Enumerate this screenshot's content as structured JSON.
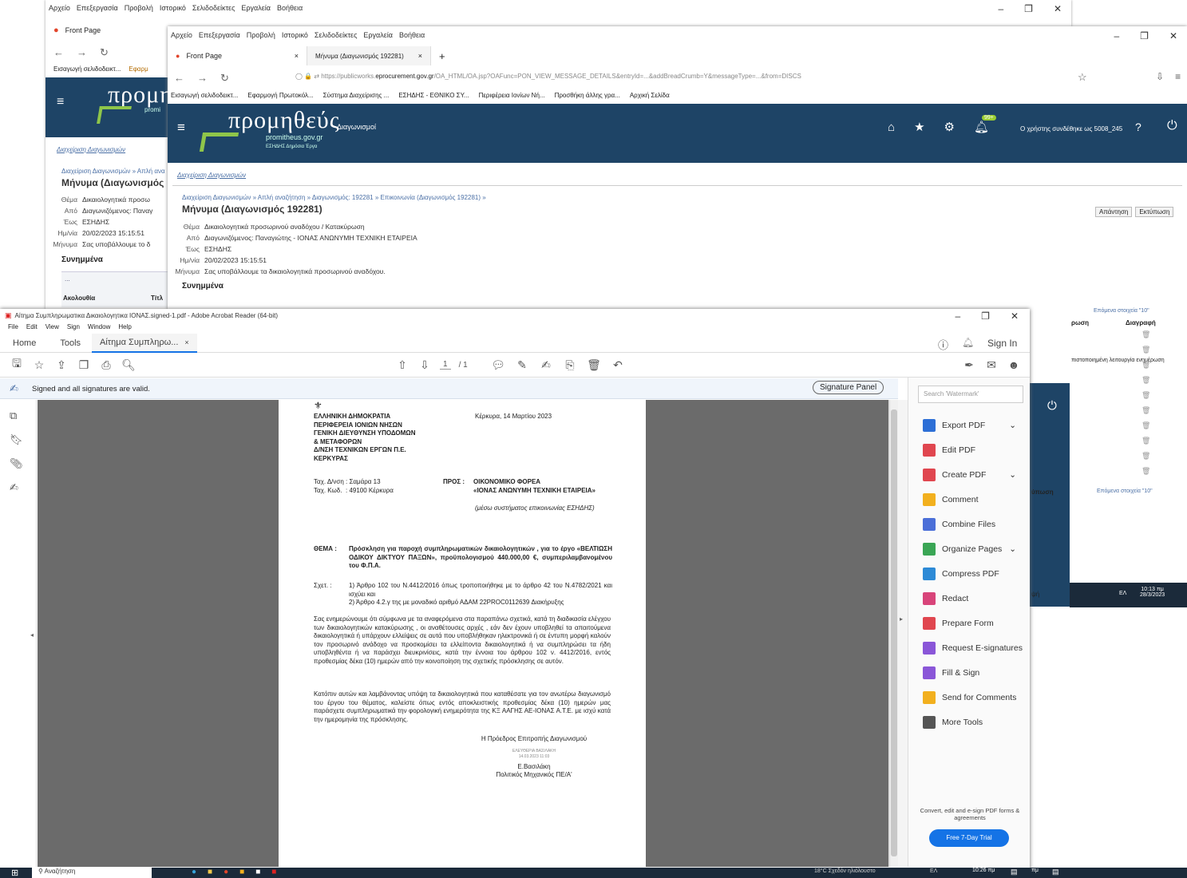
{
  "win1": {
    "menu": [
      "Αρχείο",
      "Επεξεργασία",
      "Προβολή",
      "Ιστορικό",
      "Σελιδοδείκτες",
      "Εργαλεία",
      "Βοήθεια"
    ],
    "tab_title": "Front Page",
    "bookmark1": "Εισαγωγή σελιδοδεικτ...",
    "bookmark2": "Εφαρμ",
    "logo": "προμη",
    "logo_sub": "promi",
    "nav_link": "Διαχείριση Διαγωνισμών",
    "breadcrumb": "Διαχείριση Διαγωνισμών  »  Απλή ανα",
    "title": "Μήνυμα (Διαγωνισμός",
    "fields": [
      {
        "k": "Θέμα",
        "v": "Δικαιολογητικά προσω"
      },
      {
        "k": "Από",
        "v": "Διαγωνιζόμενος: Παναγ"
      },
      {
        "k": "Έως",
        "v": "ΕΣΗΔΗΣ"
      },
      {
        "k": "Ημ/νία",
        "v": "20/02/2023 15:15:51"
      },
      {
        "k": "Μήνυμα",
        "v": "Σας υποβάλλουμε το δ"
      }
    ],
    "attachments": "Συνημμένα",
    "dots": "...",
    "col1": "Ακολουθία",
    "col2": "Τίτλ"
  },
  "win2": {
    "menu": [
      "Αρχείο",
      "Επεξεργασία",
      "Προβολή",
      "Ιστορικό",
      "Σελιδοδείκτες",
      "Εργαλεία",
      "Βοήθεια"
    ],
    "tab1": "Front Page",
    "tab2": "Μήνυμα (Διαγωνισμός 192281)",
    "url_prefix": "https://publicworks.",
    "url_domain": "eprocurement.gov.gr",
    "url_rest": "/OA_HTML/OA.jsp?OAFunc=PON_VIEW_MESSAGE_DETAILS&entryId=...&addBreadCrumb=Y&messageType=...&from=DISCS",
    "bookmarks": [
      "Εισαγωγή σελιδοδεικτ...",
      "Εφαρμογή Πρωτοκόλ...",
      "Σύστημα Διαχείρισης ...",
      "ΕΣΗΔΗΣ - ΕΘΝΙΚΟ ΣΥ...",
      "Περιφέρεια Ιονίων Νή...",
      "Προσθήκη άλλης γρα...",
      "Αρχική Σελίδα"
    ],
    "logo": "προμηθεύς",
    "logo_suffix": "Διαγωνισμοί",
    "logo_sub": "promitheus.gov.gr",
    "logo_sub2": "ΕΣΗΔΗΣ  Δημόσια Έργα",
    "badge": "99+",
    "user": "Ο χρήστης συνδέθηκε ως 5008_245",
    "nav_link": "Διαχείριση Διαγωνισμών",
    "breadcrumb": "Διαχείριση Διαγωνισμών  »  Απλή αναζήτηση  »  Διαγωνισμός: 192281  »  Επικοινωνία (Διαγωνισμός 192281)  »",
    "title": "Μήνυμα (Διαγωνισμός 192281)",
    "btn_reply": "Απάντηση",
    "btn_print": "Εκτύπωση",
    "fields": [
      {
        "k": "Θέμα",
        "v": "Δικαιολογητικά προσωρινού αναδόχου / Κατακύρωση"
      },
      {
        "k": "Από",
        "v": "Διαγωνιζόμενος: Παναγιώτης - ΙΟΝΑΣ ΑΝΩΝΥΜΗ ΤΕΧΝΙΚΗ ΕΤΑΙΡΕΙΑ"
      },
      {
        "k": "Έως",
        "v": "ΕΣΗΔΗΣ"
      },
      {
        "k": "Ημ/νία",
        "v": "20/02/2023 15:15:51"
      },
      {
        "k": "Μήνυμα",
        "v": "Σας υποβάλλουμε τα δικαιολογητικά προσωρινού αναδόχου."
      }
    ],
    "attachments": "Συνημμένα",
    "right_next": "Επόμενα στοιχεία \"10\"",
    "right_col1": "ρωση",
    "right_col2": "Διαγραφή",
    "right_note": "πιστοποιημένη λειτουργία ενημέρωση",
    "right_label": "ύπωση",
    "right_label2": "ψή",
    "clock_time": "10:13 πμ",
    "clock_date": "28/3/2023",
    "lang": "ΕΛ"
  },
  "acrobat": {
    "title": "Αίτημα Συμπληρωματικα Δικαιολογητικα ΙΟΝΑΣ.signed-1.pdf - Adobe Acrobat Reader (64-bit)",
    "menu": [
      "File",
      "Edit",
      "View",
      "Sign",
      "Window",
      "Help"
    ],
    "tab_home": "Home",
    "tab_tools": "Tools",
    "tab_doc": "Αίτημα Συμπληρω...",
    "sign_in": "Sign In",
    "page_current": "1",
    "page_total": "/ 1",
    "signed_msg": "Signed and all signatures are valid.",
    "signature_panel": "Signature Panel",
    "search_placeholder": "Search 'Watermark'",
    "tools": [
      {
        "label": "Export PDF",
        "color": "#2d6fd6",
        "chev": true
      },
      {
        "label": "Edit PDF",
        "color": "#e0464f",
        "chev": false
      },
      {
        "label": "Create PDF",
        "color": "#e0464f",
        "chev": true
      },
      {
        "label": "Comment",
        "color": "#f2b01e",
        "chev": false
      },
      {
        "label": "Combine Files",
        "color": "#4b6fd8",
        "chev": false
      },
      {
        "label": "Organize Pages",
        "color": "#3aa655",
        "chev": true
      },
      {
        "label": "Compress PDF",
        "color": "#2d8ad6",
        "chev": false
      },
      {
        "label": "Redact",
        "color": "#d8447a",
        "chev": false
      },
      {
        "label": "Prepare Form",
        "color": "#e0464f",
        "chev": false
      },
      {
        "label": "Request E-signatures",
        "color": "#8a56d8",
        "chev": false
      },
      {
        "label": "Fill & Sign",
        "color": "#8a56d8",
        "chev": false
      },
      {
        "label": "Send for Comments",
        "color": "#f2b01e",
        "chev": false
      },
      {
        "label": "More Tools",
        "color": "#555555",
        "chev": false
      }
    ],
    "promo_text": "Convert, edit and e-sign PDF forms & agreements",
    "trial_btn": "Free 7-Day Trial"
  },
  "pdf": {
    "header_left": [
      "ΕΛΛΗΝΙΚΗ ΔΗΜΟΚΡΑΤΙΑ",
      "ΠΕΡΙΦΕΡΕΙΑ ΙΟΝΙΩΝ ΝΗΣΩΝ",
      "ΓΕΝΙΚΗ ΔΙΕΥΘΥΝΣΗ ΥΠΟΔΟΜΩΝ",
      "& ΜΕΤΑΦΟΡΩΝ",
      "Δ/ΝΣΗ ΤΕΧΝΙΚΩΝ ΕΡΓΩΝ Π.Ε.",
      "ΚΕΡΚΥΡΑΣ"
    ],
    "place_date": "Κέρκυρα,  14 Μαρτίου 2023",
    "addr_k1": "Ταχ. Δ/νση",
    "addr_v1": ":   Σαμάρα 13",
    "addr_k2": "Ταχ. Κωδ.",
    "addr_v2": ":   49100 Κέρκυρα",
    "to_label": "ΠΡΟΣ :",
    "to_v1": "ΟΙΚΟΝΟΜΙΚΟ ΦΟΡΕΑ",
    "to_v2": "«ΙΟΝΑΣ ΑΝΩΝΥΜΗ ΤΕΧΝΙΚΗ ΕΤΑΙΡΕΙΑ»",
    "to_v3": "(μέσω συστήματος επικοινωνίας ΕΣΗΔΗΣ)",
    "subject_label": "ΘΕΜΑ :",
    "subject": "Πρόσκληση για παροχή συμπληρωματικών δικαιολογητικών , για το έργο «ΒΕΛΤΙΩΣΗ ΟΔΙΚΟΥ ΔΙΚΤΥΟΥ ΠΑΞΩΝ», προϋπολογισμού 440.000,00 €, συμπεριλαμβανομένου του Φ.Π.Α.",
    "rel_label": "Σχετ. :",
    "rel1": "1) Άρθρο 102 του Ν.4412/2016 όπως τροποποιήθηκε με το άρθρο 42 του Ν.4782/2021 και ισχύει και",
    "rel2": "2) Άρθρο 4.2.γ της με μοναδικό αριθμό ΑΔΑΜ 22PROC011263​9 Διακήρυξης",
    "para1": "Σας ενημερώνουμε ότι σύμφωνα με τα αναφερόμενα στα παραπάνω σχετικά, κατά τη διαδικασία ελέγχου των δικαιολογητικών κατακύρωσης , οι αναθέτουσες αρχές , εάν δεν έχουν υποβληθεί τα απαιτούμενα δικαιολογητικά ή υπάρχουν ελλείψεις σε αυτά που υποβλήθηκαν ηλεκτρονικά ή σε έντυπη μορφή καλούν τον προσωρινό ανάδοχο να προσκομίσει τα ελλείποντα δικαιολογητικά ή να συμπληρώσει τα ήδη υποβληθέντα ή να παράσχει διευκρινίσεις, κατά την έννοια του άρθρου 102 ν. 4412/2016, εντός προθεσμίας δέκα (10) ημερών από την κοινοποίηση της σχετικής πρόσκλησης σε αυτόν.",
    "para2": "Κατόπιν αυτών και λαμβάνοντας υπόψη τα δικαιολογητικά που καταθέσατε για τον ανωτέρω διαγωνισμό του έργου του θέματος, καλείστε όπως εντός αποκλειστικής προθεσμίας δέκα (10) ημερών μας παράσχετε συμπληρωματικά την φορολογική ενημερότητα της ΚΞ ΑΑΓΗΣ ΑΕ-ΙΟΝΑΣ Α.Τ.Ε. με ισχύ κατά την ημερομηνία της πρόσκλησης.",
    "sig_title": "Η Πρόεδρος Επιτροπής Διαγωνισμού",
    "sig_stamp1": "ΕΛΕΥΘΕΡΙΑ ΒΑΣΙΛΑΚΗ",
    "sig_stamp2": "14.03.2023 11:03",
    "sig_name": "Ε.Βασιλάκη",
    "sig_role": "Πολιτικός Μηχανικός ΠΕ/Α'"
  },
  "taskbar": {
    "search": "Αναζήτηση",
    "weather": "18°C  Σχεδόν ηλιόλουστο",
    "lang": "ΕΛ",
    "time": "10:26 πμ",
    "time2": "πμ"
  }
}
